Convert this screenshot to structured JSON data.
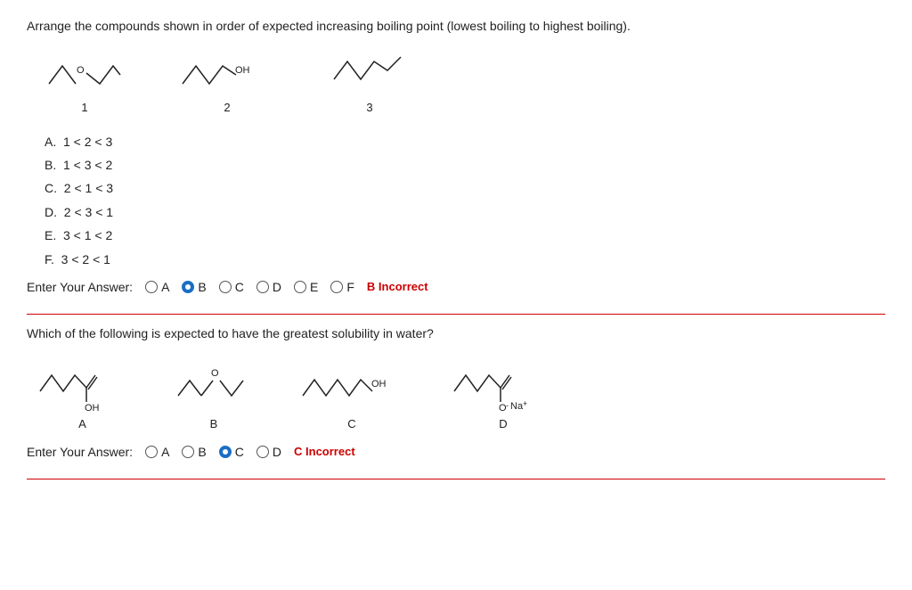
{
  "question1": {
    "text": "Arrange the compounds shown in order of expected increasing boiling point (lowest boiling to highest boiling).",
    "compounds": [
      {
        "label": "1"
      },
      {
        "label": "2"
      },
      {
        "label": "3"
      }
    ],
    "options": [
      {
        "id": "A",
        "text": "1 < 2 < 3"
      },
      {
        "id": "B",
        "text": "1 < 3 < 2"
      },
      {
        "id": "C",
        "text": "2 < 1 < 3"
      },
      {
        "id": "D",
        "text": "2 < 3 < 1"
      },
      {
        "id": "E",
        "text": "3 < 1 < 2"
      },
      {
        "id": "F",
        "text": "3 < 2 < 1"
      }
    ],
    "answer_label": "Enter Your Answer:",
    "radio_options": [
      "A",
      "B",
      "C",
      "D",
      "E",
      "F"
    ],
    "selected": "B",
    "feedback": "B Incorrect"
  },
  "question2": {
    "text": "Which of the following is expected to have the greatest solubility in water?",
    "compounds": [
      {
        "label": "A"
      },
      {
        "label": "B"
      },
      {
        "label": "C"
      },
      {
        "label": "D"
      }
    ],
    "answer_label": "Enter Your Answer:",
    "radio_options": [
      "A",
      "B",
      "C",
      "D"
    ],
    "selected": "C",
    "feedback": "C Incorrect"
  }
}
